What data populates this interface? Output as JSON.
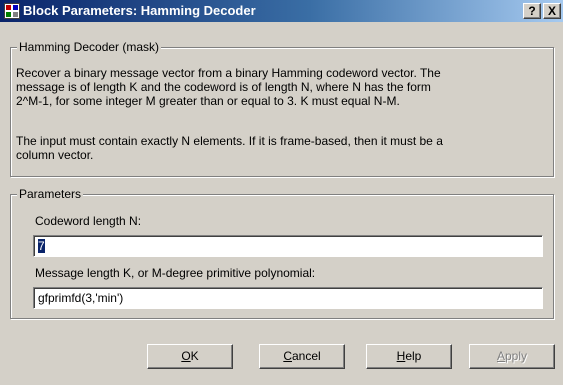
{
  "window": {
    "title": "Block Parameters: Hamming Decoder",
    "help_glyph": "?",
    "close_glyph": "X"
  },
  "description": {
    "group_label": "Hamming Decoder (mask)",
    "paragraph1_lines": [
      "Recover a binary message vector from a binary Hamming codeword vector.  The",
      "message is of length K and the codeword is of length N, where N has the form",
      "2^M-1, for some integer M greater than or equal to 3.  K must equal N-M."
    ],
    "paragraph2_lines": [
      "The input must contain exactly N elements.  If it is frame-based, then it must be a",
      "column vector."
    ]
  },
  "parameters": {
    "group_label": "Parameters",
    "codeword": {
      "label": "Codeword length N:",
      "value": "7",
      "selected": true
    },
    "message": {
      "label": "Message length K, or M-degree primitive polynomial:",
      "value": "gfprimfd(3,'min')"
    }
  },
  "buttons": {
    "ok": {
      "accel": "O",
      "rest": "K",
      "enabled": true
    },
    "cancel": {
      "accel": "C",
      "rest": "ancel",
      "enabled": true
    },
    "help": {
      "accel": "H",
      "rest": "elp",
      "enabled": true
    },
    "apply": {
      "accel": "A",
      "rest": "pply",
      "enabled": false
    }
  },
  "colors": {
    "title_gradient_start": "#0a246a",
    "title_gradient_end": "#a6caf0",
    "face": "#d4d0c8",
    "selection": "#0a246a"
  },
  "icons": [
    "simulink-block-icon",
    "help-icon",
    "close-icon"
  ]
}
